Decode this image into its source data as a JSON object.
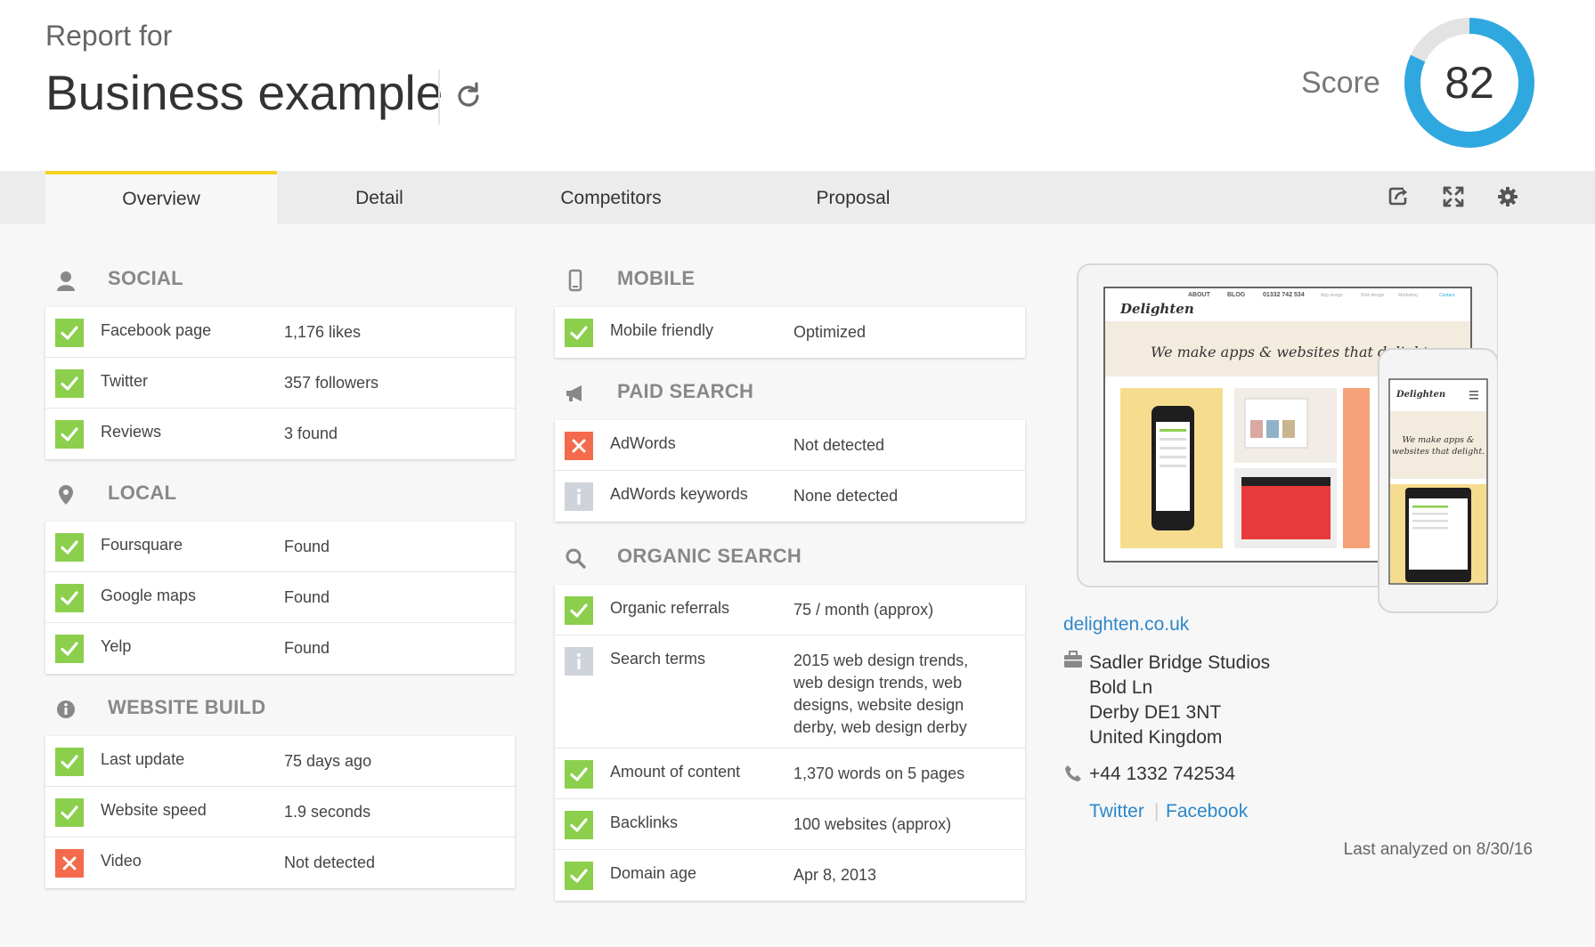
{
  "header": {
    "report_for": "Report for",
    "business_name": "Business example",
    "score_label": "Score",
    "score_value": "82",
    "score_fraction": 0.82
  },
  "tabs": [
    {
      "label": "Overview",
      "active": true
    },
    {
      "label": "Detail",
      "active": false
    },
    {
      "label": "Competitors",
      "active": false
    },
    {
      "label": "Proposal",
      "active": false
    }
  ],
  "tools": [
    "share-icon",
    "expand-icon",
    "gear-icon"
  ],
  "sections": {
    "social": {
      "title": "SOCIAL",
      "icon": "person-icon",
      "rows": [
        {
          "label": "Facebook page",
          "value": "1,176 likes",
          "status": "ok"
        },
        {
          "label": "Twitter",
          "value": "357 followers",
          "status": "ok"
        },
        {
          "label": "Reviews",
          "value": "3 found",
          "status": "ok"
        }
      ]
    },
    "local": {
      "title": "LOCAL",
      "icon": "map-pin-icon",
      "rows": [
        {
          "label": "Foursquare",
          "value": "Found",
          "status": "ok"
        },
        {
          "label": "Google maps",
          "value": "Found",
          "status": "ok"
        },
        {
          "label": "Yelp",
          "value": "Found",
          "status": "ok"
        }
      ]
    },
    "website_build": {
      "title": "WEBSITE BUILD",
      "icon": "info-icon",
      "rows": [
        {
          "label": "Last update",
          "value": "75 days ago",
          "status": "ok"
        },
        {
          "label": "Website speed",
          "value": "1.9 seconds",
          "status": "ok"
        },
        {
          "label": "Video",
          "value": "Not detected",
          "status": "bad"
        }
      ]
    },
    "mobile": {
      "title": "MOBILE",
      "icon": "mobile-phone-icon",
      "rows": [
        {
          "label": "Mobile friendly",
          "value": "Optimized",
          "status": "ok"
        }
      ]
    },
    "paid_search": {
      "title": "PAID SEARCH",
      "icon": "megaphone-icon",
      "rows": [
        {
          "label": "AdWords",
          "value": "Not detected",
          "status": "bad"
        },
        {
          "label": "AdWords keywords",
          "value": "None detected",
          "status": "info"
        }
      ]
    },
    "organic_search": {
      "title": "ORGANIC SEARCH",
      "icon": "search-icon",
      "rows": [
        {
          "label": "Organic referrals",
          "value": "75 / month (approx)",
          "status": "ok"
        },
        {
          "label": "Search terms",
          "value": "2015 web design trends,\nweb design trends, web\ndesigns, website design\nderby, web design derby",
          "status": "info"
        },
        {
          "label": "Amount of content",
          "value": "1,370 words on 5 pages",
          "status": "ok"
        },
        {
          "label": "Backlinks",
          "value": "100 websites (approx)",
          "status": "ok"
        },
        {
          "label": "Domain age",
          "value": "Apr 8, 2013",
          "status": "ok"
        }
      ]
    }
  },
  "preview": {
    "nav": [
      "ABOUT",
      "BLOG",
      "01332 742 534",
      "App design",
      "Web design",
      "Marketing",
      "Contact"
    ],
    "logo": "Delighten",
    "headline": "We make apps & websites that delight",
    "mobile_headline_1": "We make apps &",
    "mobile_headline_2": "websites that delight."
  },
  "contact": {
    "website": "delighten.co.uk",
    "address_line1": "Sadler Bridge Studios",
    "address_line2": "Bold Ln",
    "address_line3": "Derby DE1 3NT",
    "address_line4": "United Kingdom",
    "phone": "+44 1332 742534",
    "twitter": "Twitter",
    "facebook": "Facebook",
    "last_analyzed": "Last analyzed on 8/30/16"
  },
  "colors": {
    "ok": "#8ccf4d",
    "bad": "#f36b4c",
    "info": "#cfd3da",
    "score_ring": "#2fa8e0",
    "tab_accent": "#f5d31c",
    "link": "#2e87c9"
  }
}
